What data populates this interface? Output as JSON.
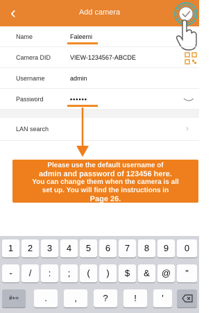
{
  "header": {
    "title": "Add camera",
    "back_icon": "back-chevron-icon",
    "confirm_icon": "check-circle-icon"
  },
  "form": {
    "name": {
      "label": "Name",
      "value": "Faleemi"
    },
    "camera_did": {
      "label": "Camera DID",
      "value": "VIEW-1234567-ABCDE",
      "icon": "qr-code-icon"
    },
    "username": {
      "label": "Username",
      "value": "admin"
    },
    "password": {
      "label": "Password",
      "value": "••••••",
      "icon": "eye-closed-icon"
    }
  },
  "lan_search": {
    "label": "LAN search"
  },
  "instruction": {
    "line1": "Please use the default username of",
    "line2": "admin and password of 123456 here.",
    "line3": "You can change them when the camera is all",
    "line4": "set up. You will find the instructions in",
    "line5": "Page 26."
  },
  "keyboard": {
    "row1": [
      "1",
      "2",
      "3",
      "4",
      "5",
      "6",
      "7",
      "8",
      "9",
      "0"
    ],
    "row2": [
      "-",
      "/",
      ":",
      ";",
      "(",
      ")",
      "$",
      "&",
      "@",
      "\""
    ],
    "row3": [
      ".",
      ",",
      "?",
      "!",
      "'"
    ],
    "mode_key": "#+=",
    "delete_icon": "backspace-icon"
  },
  "colors": {
    "accent": "#ee7f1c",
    "header": "#e8832f",
    "keyboard": "#d3d5db"
  }
}
